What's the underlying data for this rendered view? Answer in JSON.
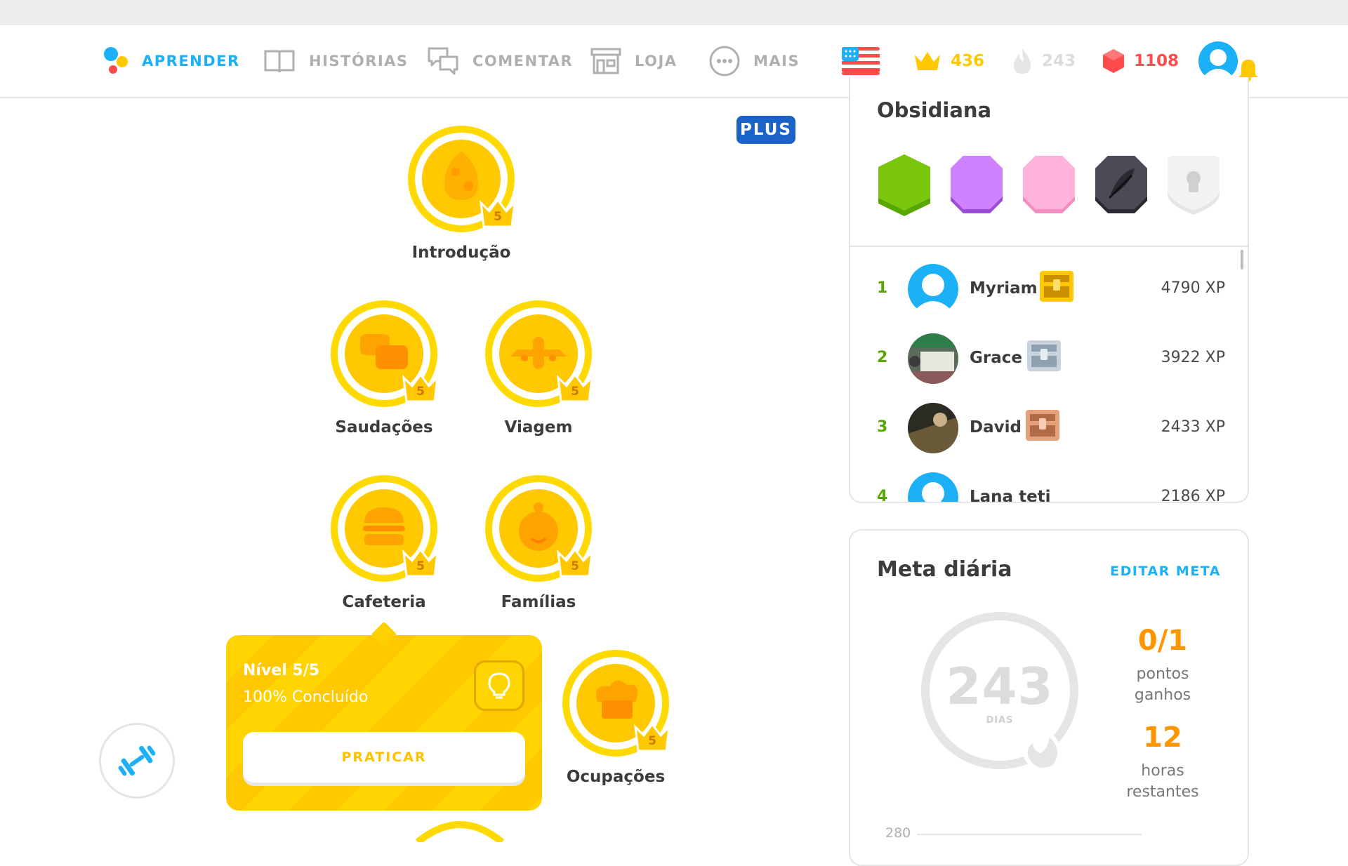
{
  "nav": {
    "learn": "APRENDER",
    "stories": "HISTÓRIAS",
    "discuss": "COMENTAR",
    "shop": "LOJA",
    "more": "MAIS"
  },
  "stats": {
    "crowns": "436",
    "streak": "243",
    "gems": "1108"
  },
  "plus_badge": "PLUS",
  "skills": {
    "intro": {
      "name": "Introdução",
      "crown_level": "5"
    },
    "greetings": {
      "name": "Saudações",
      "crown_level": "5"
    },
    "travel": {
      "name": "Viagem",
      "crown_level": "5"
    },
    "cafe": {
      "name": "Cafeteria",
      "crown_level": "5"
    },
    "family": {
      "name": "Famílias",
      "crown_level": "5"
    },
    "jobs": {
      "name": "Ocupações",
      "crown_level": "5"
    }
  },
  "popup": {
    "level": "Nível 5/5",
    "progress": "100% Concluído",
    "practice": "PRATICAR"
  },
  "league": {
    "title": "Obsidiana",
    "rows": [
      {
        "rank": "1",
        "name": "Myriam",
        "xp": "4790 XP"
      },
      {
        "rank": "2",
        "name": "Grace",
        "xp": "3922 XP"
      },
      {
        "rank": "3",
        "name": "David",
        "xp": "2433 XP"
      },
      {
        "rank": "4",
        "name": "Lana teti",
        "xp": "2186 XP"
      }
    ]
  },
  "goal": {
    "title": "Meta diária",
    "edit": "EDITAR META",
    "days": "243",
    "days_label": "DIAS",
    "points": "0/1",
    "points_label_1": "pontos",
    "points_label_2": "ganhos",
    "hours": "12",
    "hours_label_1": "horas",
    "hours_label_2": "restantes",
    "axis_value": "280"
  },
  "colors": {
    "accent_blue": "#1cb0f6",
    "gold": "#ffc800",
    "gems_red": "#ff4b4b",
    "rank_green": "#58a700",
    "goal_orange": "#ff9600"
  }
}
